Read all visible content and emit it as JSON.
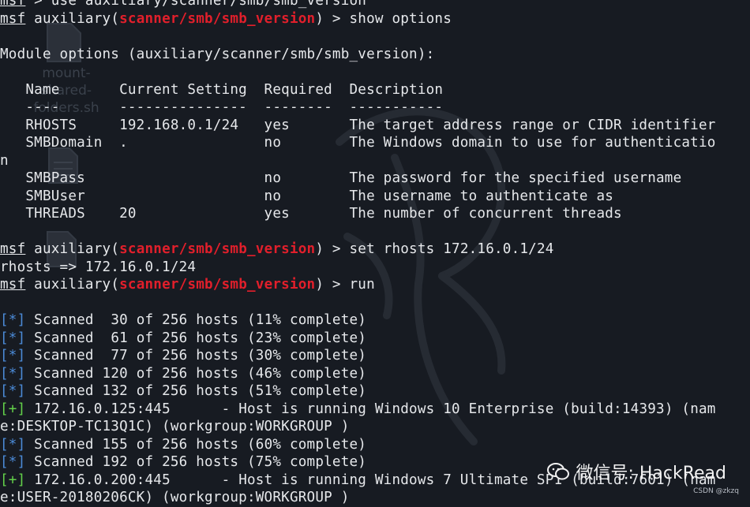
{
  "desktop": {
    "icons": [
      {
        "label": "#!",
        "kind": "script"
      },
      {
        "label": "mount-\nshared-\nfolders.sh",
        "kind": "script"
      },
      {
        "label": "txt",
        "kind": "text"
      },
      {
        "label": "",
        "kind": "text"
      }
    ]
  },
  "terminal": {
    "prompt": "msf",
    "module": "scanner/smb/smb_version",
    "lines": [
      {
        "type": "cmd",
        "plain": true,
        "text": " > use auxiliary/scanner/smb/smb_version"
      },
      {
        "type": "cmd",
        "text": ") > show options"
      },
      {
        "type": "blank"
      },
      {
        "type": "text",
        "text": "Module options (auxiliary/scanner/smb/smb_version):"
      },
      {
        "type": "blank"
      },
      {
        "type": "text",
        "text": "   Name       Current Setting  Required  Description"
      },
      {
        "type": "text",
        "text": "   ----       ---------------  --------  -----------"
      },
      {
        "type": "text",
        "text": "   RHOSTS     192.168.0.1/24   yes       The target address range or CIDR identifier"
      },
      {
        "type": "text",
        "text": "   SMBDomain  .                no        The Windows domain to use for authenticatio"
      },
      {
        "type": "text",
        "text": "n"
      },
      {
        "type": "text",
        "text": "   SMBPass                     no        The password for the specified username"
      },
      {
        "type": "text",
        "text": "   SMBUser                     no        The username to authenticate as"
      },
      {
        "type": "text",
        "text": "   THREADS    20               yes       The number of concurrent threads"
      },
      {
        "type": "blank"
      },
      {
        "type": "cmd",
        "text": ") > set rhosts 172.16.0.1/24"
      },
      {
        "type": "text",
        "text": "rhosts => 172.16.0.1/24"
      },
      {
        "type": "cmd",
        "text": ") > run"
      },
      {
        "type": "blank"
      },
      {
        "type": "status",
        "mark": "[*]",
        "text": " Scanned  30 of 256 hosts (11% complete)"
      },
      {
        "type": "status",
        "mark": "[*]",
        "text": " Scanned  61 of 256 hosts (23% complete)"
      },
      {
        "type": "status",
        "mark": "[*]",
        "text": " Scanned  77 of 256 hosts (30% complete)"
      },
      {
        "type": "status",
        "mark": "[*]",
        "text": " Scanned 120 of 256 hosts (46% complete)"
      },
      {
        "type": "status",
        "mark": "[*]",
        "text": " Scanned 132 of 256 hosts (51% complete)"
      },
      {
        "type": "good",
        "mark": "[+]",
        "text": " 172.16.0.125:445      - Host is running Windows 10 Enterprise (build:14393) (nam"
      },
      {
        "type": "text",
        "text": "e:DESKTOP-TC13Q1C) (workgroup:WORKGROUP )"
      },
      {
        "type": "status",
        "mark": "[*]",
        "text": " Scanned 155 of 256 hosts (60% complete)"
      },
      {
        "type": "status",
        "mark": "[*]",
        "text": " Scanned 192 of 256 hosts (75% complete)"
      },
      {
        "type": "good",
        "mark": "[+]",
        "text": " 172.16.0.200:445      - Host is running Windows 7 Ultimate SP1 (build:7601) (nam"
      },
      {
        "type": "text",
        "text": "e:USER-20180206CK) (workgroup:WORKGROUP )"
      }
    ]
  },
  "watermark": {
    "text": "微信号: HackRead",
    "credit": "CSDN @zkzq"
  },
  "colors": {
    "background": "#171b22",
    "text": "#e6e8eb",
    "module": "#e11f2b",
    "info_marker": "#4b8ad6",
    "success_marker": "#63d14a"
  }
}
